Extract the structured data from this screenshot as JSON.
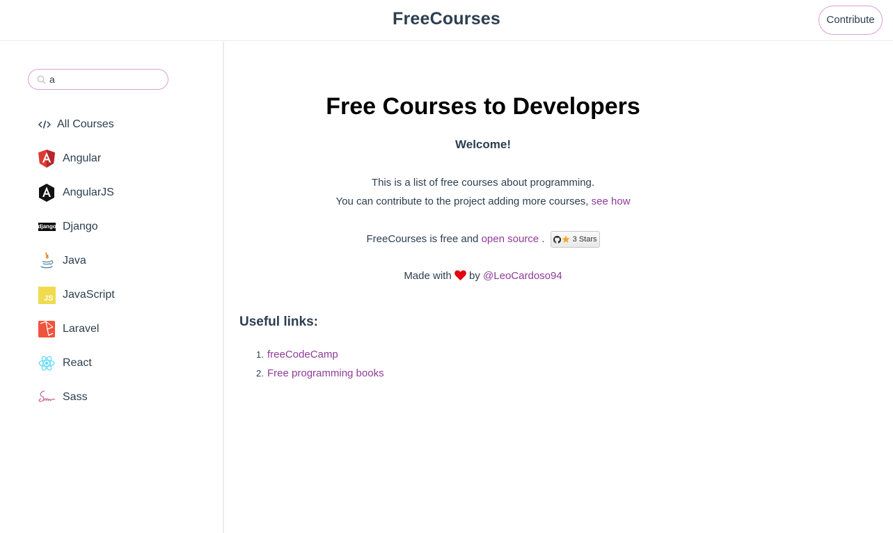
{
  "header": {
    "brand": "FreeCourses",
    "contribute_label": "Contribute"
  },
  "sidebar": {
    "search": {
      "value": "a",
      "placeholder": ""
    },
    "items": [
      {
        "label": "All Courses",
        "icon": "code-icon"
      },
      {
        "label": "Angular",
        "icon": "angular-icon"
      },
      {
        "label": "AngularJS",
        "icon": "angularjs-icon"
      },
      {
        "label": "Django",
        "icon": "django-icon"
      },
      {
        "label": "Java",
        "icon": "java-icon"
      },
      {
        "label": "JavaScript",
        "icon": "javascript-icon"
      },
      {
        "label": "Laravel",
        "icon": "laravel-icon"
      },
      {
        "label": "React",
        "icon": "react-icon"
      },
      {
        "label": "Sass",
        "icon": "sass-icon"
      }
    ],
    "icon_labels": {
      "django": "django",
      "javascript": "JS"
    }
  },
  "main": {
    "title": "Free Courses to Developers",
    "welcome": "Welcome!",
    "intro_line1": "This is a list of free courses about programming.",
    "intro_line2": "You can contribute to the project adding more courses,",
    "see_how": "see how",
    "free_text": "FreeCourses is free and",
    "open_source": "open source",
    "period": ".",
    "stars_badge": "3 Stars",
    "made_with": "Made with",
    "by": "by",
    "author": "@LeoCardoso94",
    "useful_title": "Useful links:",
    "useful_links": [
      {
        "num": "1.",
        "label": "freeCodeCamp"
      },
      {
        "num": "2.",
        "label": "Free programming books"
      }
    ]
  },
  "colors": {
    "accent": "#8e3a99",
    "border_accent": "#d89fd6",
    "text": "#2c3e50",
    "heart": "#e3000f"
  }
}
